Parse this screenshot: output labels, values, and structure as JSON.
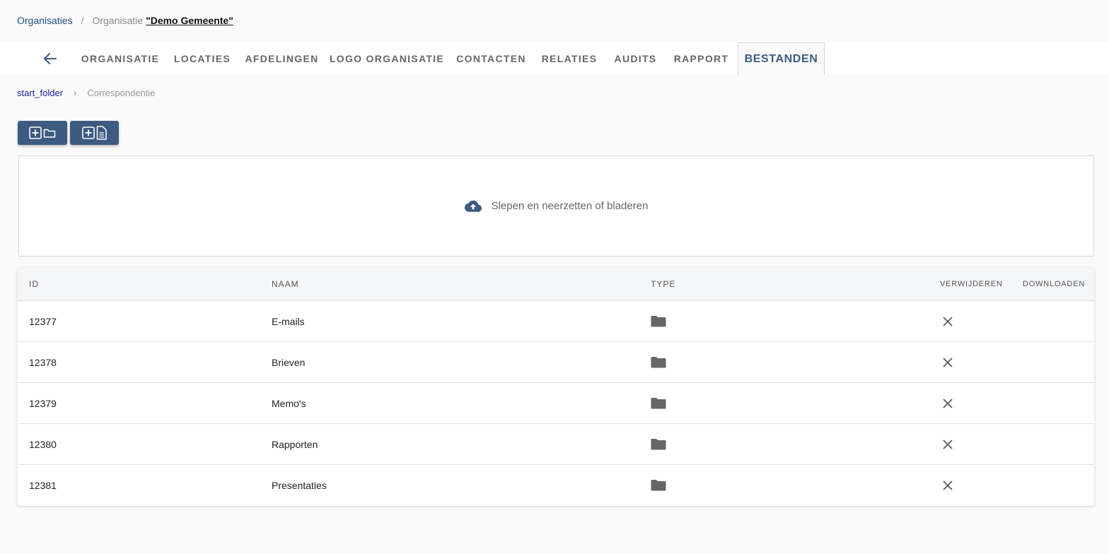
{
  "breadcrumb": {
    "root": "Organisaties",
    "separator": "/",
    "current_prefix": "Organisatie",
    "current_name": "\"Demo Gemeente\""
  },
  "tabs": [
    {
      "label": "ORGANISATIE"
    },
    {
      "label": "LOCATIES"
    },
    {
      "label": "AFDELINGEN"
    },
    {
      "label": "LOGO ORGANISATIE"
    },
    {
      "label": "CONTACTEN"
    },
    {
      "label": "RELATIES"
    },
    {
      "label": "AUDITS"
    },
    {
      "label": "RAPPORT"
    },
    {
      "label": "BESTANDEN",
      "active": true
    }
  ],
  "folder_path": {
    "root": "start_folder",
    "separator": "›",
    "current": "Correspondentie"
  },
  "toolbar": {
    "new_folder_icon": "add-folder-icon",
    "new_file_icon": "add-file-icon"
  },
  "dropzone": {
    "icon": "cloud-upload-icon",
    "text": "Slepen en neerzetten of bladeren"
  },
  "table": {
    "headers": {
      "id": "ID",
      "name": "NAAM",
      "type": "TYPE",
      "delete": "VERWIJDEREN",
      "download": "DOWNLOADEN"
    },
    "rows": [
      {
        "id": "12377",
        "name": "E-mails",
        "type": "folder"
      },
      {
        "id": "12378",
        "name": "Brieven",
        "type": "folder"
      },
      {
        "id": "12379",
        "name": "Memo's",
        "type": "folder"
      },
      {
        "id": "12380",
        "name": "Rapporten",
        "type": "folder"
      },
      {
        "id": "12381",
        "name": "Presentaties",
        "type": "folder"
      }
    ]
  },
  "colors": {
    "accent": "#3d5a80",
    "link": "#1f4f8a"
  }
}
